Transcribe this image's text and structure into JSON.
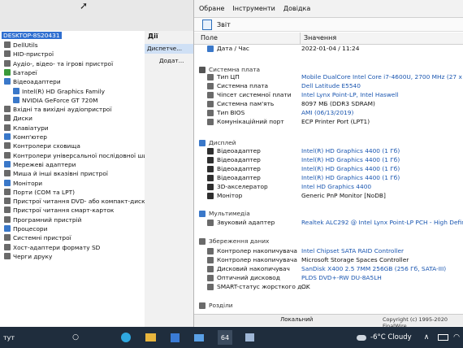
{
  "menubar": {
    "items": [
      "Обране",
      "Інструменти",
      "Довідка"
    ]
  },
  "report": {
    "title": "Звіт"
  },
  "columns": {
    "field": "Поле",
    "value": "Значення"
  },
  "details": [
    {
      "label": "Дата / Час",
      "value": "2022-01-04 / 11:24",
      "indent": 1,
      "color": "dark",
      "icon": "#3a78c9"
    },
    {
      "label": "Системна плата",
      "value": "",
      "indent": 0,
      "section": true,
      "icon": "#555"
    },
    {
      "label": "Тип ЦП",
      "value": "Mobile DualCore Intel Core i7-4600U, 2700 MHz (27 x 100)",
      "indent": 1,
      "color": "blue",
      "icon": "#6a6a6a"
    },
    {
      "label": "Системна плата",
      "value": "Dell Latitude E5540",
      "indent": 1,
      "color": "blue",
      "icon": "#6a6a6a"
    },
    {
      "label": "Чіпсет системної плати",
      "value": "Intel Lynx Point-LP, Intel Haswell",
      "indent": 1,
      "color": "blue",
      "icon": "#6a6a6a"
    },
    {
      "label": "Системна пам'ять",
      "value": "8097 МБ  (DDR3 SDRAM)",
      "indent": 1,
      "color": "dark",
      "icon": "#6a6a6a"
    },
    {
      "label": "Тип BIOS",
      "value": "AMI (06/13/2019)",
      "indent": 1,
      "color": "blue",
      "icon": "#6a6a6a"
    },
    {
      "label": "Комунікаційний порт",
      "value": "ECP Printer Port (LPT1)",
      "indent": 1,
      "color": "dark",
      "icon": "#6a6a6a"
    },
    {
      "label": "Дисплей",
      "value": "",
      "indent": 0,
      "section": true,
      "icon": "#3a78c9"
    },
    {
      "label": "Відеоадаптер",
      "value": "Intel(R) HD Graphics 4400  (1 Гб)",
      "indent": 1,
      "color": "blue",
      "icon": "#2f2f2f"
    },
    {
      "label": "Відеоадаптер",
      "value": "Intel(R) HD Graphics 4400  (1 Гб)",
      "indent": 1,
      "color": "blue",
      "icon": "#2f2f2f"
    },
    {
      "label": "Відеоадаптер",
      "value": "Intel(R) HD Graphics 4400  (1 Гб)",
      "indent": 1,
      "color": "blue",
      "icon": "#2f2f2f"
    },
    {
      "label": "Відеоадаптер",
      "value": "Intel(R) HD Graphics 4400  (1 Гб)",
      "indent": 1,
      "color": "blue",
      "icon": "#2f2f2f"
    },
    {
      "label": "3D-акселератор",
      "value": "Intel HD Graphics 4400",
      "indent": 1,
      "color": "blue",
      "icon": "#2f2f2f"
    },
    {
      "label": "Монітор",
      "value": "Generic PnP Monitor [NoDB]",
      "indent": 1,
      "color": "dark",
      "icon": "#2f2f2f"
    },
    {
      "label": "Мультимедіа",
      "value": "",
      "indent": 0,
      "section": true,
      "icon": "#3a78c9"
    },
    {
      "label": "Звуковий адаптер",
      "value": "Realtek ALC292 @ Intel Lynx Point-LP PCH - High Definition",
      "indent": 1,
      "color": "blue",
      "icon": "#6a6a6a"
    },
    {
      "label": "Збереження даних",
      "value": "",
      "indent": 0,
      "section": true,
      "icon": "#6a6a6a"
    },
    {
      "label": "Контролер накопичувача",
      "value": "Intel Chipset SATA RAID Controller",
      "indent": 1,
      "color": "blue",
      "icon": "#6a6a6a"
    },
    {
      "label": "Контролер накопичувача",
      "value": "Microsoft Storage Spaces Controller",
      "indent": 1,
      "color": "dark",
      "icon": "#6a6a6a"
    },
    {
      "label": "Дисковий накопичувач",
      "value": "SanDisk X400 2.5 7MM 256GB  (256 Гб, SATA-III)",
      "indent": 1,
      "color": "blue",
      "icon": "#6a6a6a"
    },
    {
      "label": "Оптичний дисковод",
      "value": "PLDS DVD+-RW DU-8A5LH",
      "indent": 1,
      "color": "blue",
      "icon": "#6a6a6a"
    },
    {
      "label": "SMART-статус жорсткого д...",
      "value": "OK",
      "indent": 1,
      "color": "dark",
      "icon": "#6a6a6a"
    },
    {
      "label": "Розділи",
      "value": "",
      "indent": 0,
      "section": true,
      "icon": "#6a6a6a"
    }
  ],
  "statusbar": {
    "left": "Локальний",
    "right": "Copyright (c) 1995-2020 FinalWire"
  },
  "tree": {
    "root": "DESKTOP-8S20431",
    "items": [
      {
        "label": "DellUtils",
        "indent": 1,
        "icon": "#6a6a6a"
      },
      {
        "label": "HID-пристрої",
        "indent": 1,
        "icon": "#6a6a6a"
      },
      {
        "label": "Аудіо-, відео- та ігрові пристрої",
        "indent": 1,
        "icon": "#6a6a6a"
      },
      {
        "label": "Батареї",
        "indent": 1,
        "icon": "#3a9a3a"
      },
      {
        "label": "Відеоадаптери",
        "indent": 1,
        "icon": "#3a78c9"
      },
      {
        "label": "Intel(R) HD Graphics Family",
        "indent": 2,
        "icon": "#3a78c9"
      },
      {
        "label": "NVIDIA GeForce GT 720M",
        "indent": 2,
        "icon": "#3a78c9"
      },
      {
        "label": "Вхідні та вихідні аудіопристрої",
        "indent": 1,
        "icon": "#6a6a6a"
      },
      {
        "label": "Диски",
        "indent": 1,
        "icon": "#6a6a6a"
      },
      {
        "label": "Клавіатури",
        "indent": 1,
        "icon": "#6a6a6a"
      },
      {
        "label": "Комп'ютер",
        "indent": 1,
        "icon": "#3a78c9"
      },
      {
        "label": "Контролери сховища",
        "indent": 1,
        "icon": "#6a6a6a"
      },
      {
        "label": "Контролери універсальної послідовної шини",
        "indent": 1,
        "icon": "#6a6a6a"
      },
      {
        "label": "Мережеві адаптери",
        "indent": 1,
        "icon": "#3a78c9"
      },
      {
        "label": "Миша й інші вказівні пристрої",
        "indent": 1,
        "icon": "#6a6a6a"
      },
      {
        "label": "Монітори",
        "indent": 1,
        "icon": "#3a78c9"
      },
      {
        "label": "Порти (COM та LPT)",
        "indent": 1,
        "icon": "#6a6a6a"
      },
      {
        "label": "Пристрої читання DVD- або компакт-дисків",
        "indent": 1,
        "icon": "#6a6a6a"
      },
      {
        "label": "Пристрої читання смарт-карток",
        "indent": 1,
        "icon": "#6a6a6a"
      },
      {
        "label": "Програмний пристрій",
        "indent": 1,
        "icon": "#6a6a6a"
      },
      {
        "label": "Процесори",
        "indent": 1,
        "icon": "#3a78c9"
      },
      {
        "label": "Системні пристрої",
        "indent": 1,
        "icon": "#6a6a6a"
      },
      {
        "label": "Хост-адаптери формату SD",
        "indent": 1,
        "icon": "#6a6a6a"
      },
      {
        "label": "Черги друку",
        "indent": 1,
        "icon": "#6a6a6a"
      }
    ]
  },
  "actions": {
    "header": "Дії",
    "item1": "Диспетче...",
    "item2": "Додат..."
  },
  "taskbar": {
    "left_text": "тут",
    "weather": "-6°C  Cloudy",
    "app_badge": "64"
  }
}
